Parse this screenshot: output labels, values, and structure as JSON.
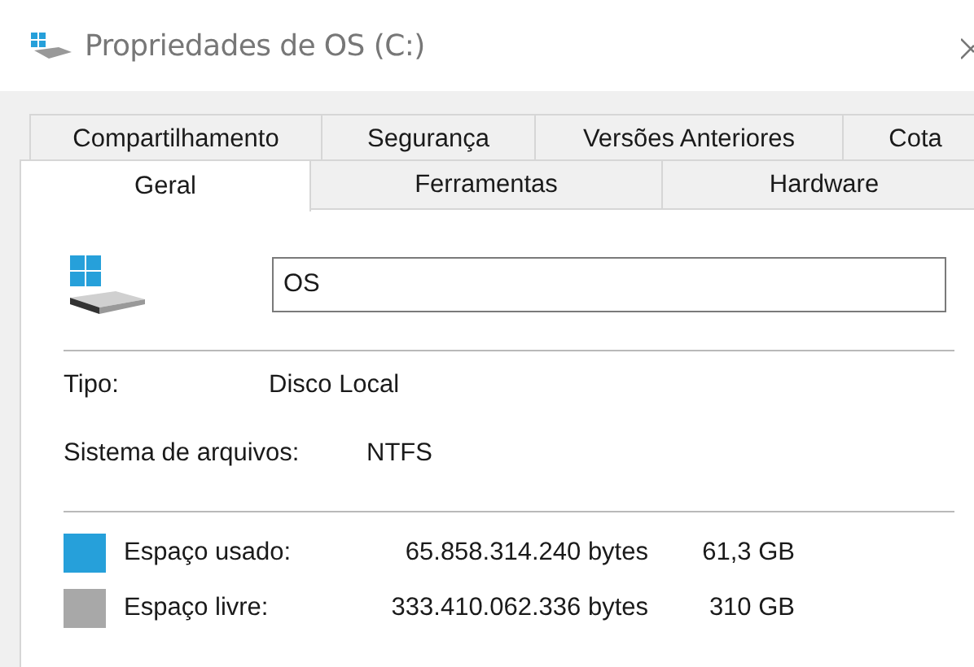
{
  "window": {
    "title": "Propriedades de OS (C:)"
  },
  "tab_rows": [
    [
      {
        "label": "Compartilhamento",
        "selected": false
      },
      {
        "label": "Segurança",
        "selected": false
      },
      {
        "label": "Versões Anteriores",
        "selected": false
      },
      {
        "label": "Cota",
        "selected": false
      }
    ],
    [
      {
        "label": "Geral",
        "selected": true
      },
      {
        "label": "Ferramentas",
        "selected": false
      },
      {
        "label": "Hardware",
        "selected": false
      }
    ]
  ],
  "name_field": {
    "value": "OS"
  },
  "properties": [
    {
      "label": "Tipo:",
      "value": "Disco Local"
    },
    {
      "label": "Sistema de arquivos:",
      "value": "NTFS"
    }
  ],
  "space": [
    {
      "label": "Espaço usado:",
      "bytes": "65.858.314.240 bytes",
      "size": "61,3 GB",
      "color": "#26a0da"
    },
    {
      "label": "Espaço livre:",
      "bytes": "333.410.062.336 bytes",
      "size": "310 GB",
      "color": "#a8a8a8"
    }
  ]
}
